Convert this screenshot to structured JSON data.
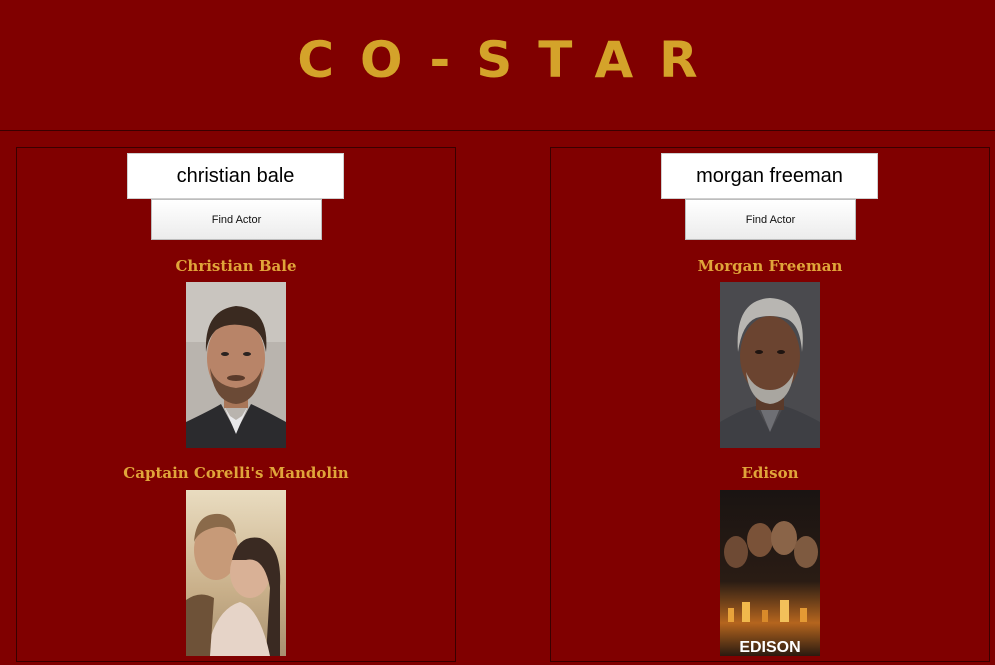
{
  "header": {
    "title": "CO-STAR"
  },
  "left_panel": {
    "search_value": "christian bale",
    "button_label": "Find Actor",
    "actor_name": "Christian Bale",
    "movie_title": "Captain Corelli's Mandolin"
  },
  "right_panel": {
    "search_value": "morgan freeman",
    "button_label": "Find Actor",
    "actor_name": "Morgan Freeman",
    "movie_title": "Edison",
    "poster_text": "EDISON"
  },
  "colors": {
    "background": "#800000",
    "accent": "#d4a32a"
  }
}
